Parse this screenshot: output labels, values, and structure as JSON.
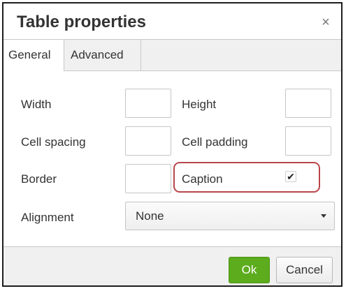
{
  "dialog": {
    "title": "Table properties",
    "close_glyph": "×",
    "close_icon": "close-icon"
  },
  "tabs": [
    {
      "label": "General",
      "active": true
    },
    {
      "label": "Advanced",
      "active": false
    }
  ],
  "fields": {
    "width": {
      "label": "Width",
      "value": ""
    },
    "height": {
      "label": "Height",
      "value": ""
    },
    "cell_spacing": {
      "label": "Cell spacing",
      "value": ""
    },
    "cell_padding": {
      "label": "Cell padding",
      "value": ""
    },
    "border": {
      "label": "Border",
      "value": ""
    },
    "caption": {
      "label": "Caption",
      "checked": true,
      "check_glyph": "✔"
    },
    "alignment": {
      "label": "Alignment",
      "selected": "None"
    }
  },
  "footer": {
    "ok_label": "Ok",
    "cancel_label": "Cancel"
  },
  "colors": {
    "ok_button": "#5dac1d",
    "caption_highlight": "#b8454a"
  }
}
